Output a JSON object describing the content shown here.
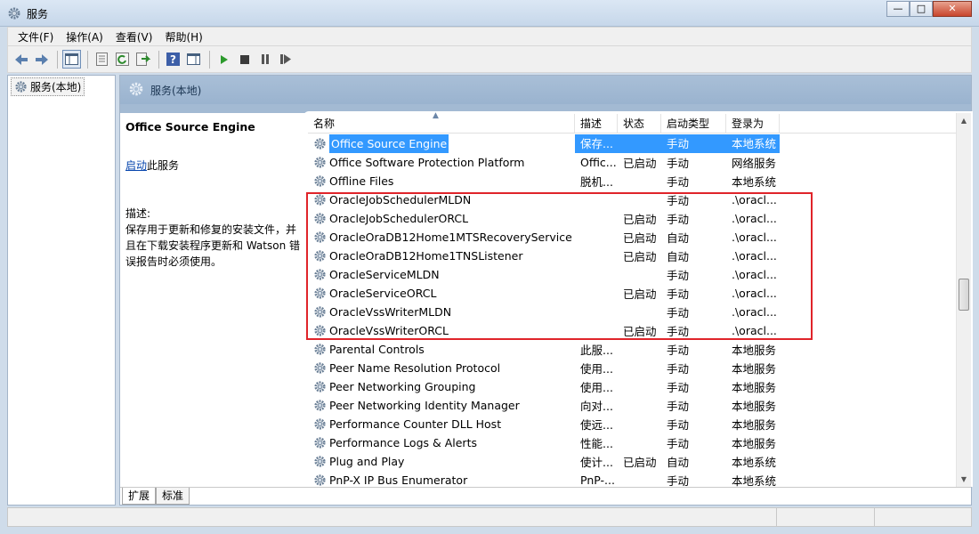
{
  "window": {
    "title": "服务",
    "buttons": {
      "minimize": "—",
      "maximize": "□",
      "close": "✕"
    }
  },
  "menu": [
    "文件(F)",
    "操作(A)",
    "查看(V)",
    "帮助(H)"
  ],
  "toolbar_icons": [
    "back-icon",
    "forward-icon",
    "console-tree-icon",
    "properties-icon",
    "refresh-icon",
    "export-list-icon",
    "help-icon",
    "show-action-pane-icon",
    "start-service-icon",
    "stop-service-icon",
    "pause-service-icon",
    "restart-service-icon"
  ],
  "tree": {
    "item_label": "服务(本地)"
  },
  "pane": {
    "header": "服务(本地)"
  },
  "details": {
    "title": "Office  Source Engine",
    "start_link": "启动",
    "start_suffix": "此服务",
    "desc_label": "描述:",
    "desc_text": "保存用于更新和修复的安装文件，并且在下载安装程序更新和 Watson 错误报告时必须使用。"
  },
  "columns": {
    "name": "名称",
    "desc": "描述",
    "status": "状态",
    "start": "启动类型",
    "logon": "登录为"
  },
  "rows": [
    {
      "name": "Office  Source Engine",
      "desc": "保存...",
      "status": "",
      "start": "手动",
      "logon": "本地系统"
    },
    {
      "name": "Office Software Protection Platform",
      "desc": "Offic...",
      "status": "已启动",
      "start": "手动",
      "logon": "网络服务"
    },
    {
      "name": "Offline Files",
      "desc": "脱机...",
      "status": "",
      "start": "手动",
      "logon": "本地系统"
    },
    {
      "name": "OracleJobSchedulerMLDN",
      "desc": "",
      "status": "",
      "start": "手动",
      "logon": ".\\oracl..."
    },
    {
      "name": "OracleJobSchedulerORCL",
      "desc": "",
      "status": "已启动",
      "start": "手动",
      "logon": ".\\oracl..."
    },
    {
      "name": "OracleOraDB12Home1MTSRecoveryService",
      "desc": "",
      "status": "已启动",
      "start": "自动",
      "logon": ".\\oracl..."
    },
    {
      "name": "OracleOraDB12Home1TNSListener",
      "desc": "",
      "status": "已启动",
      "start": "自动",
      "logon": ".\\oracl..."
    },
    {
      "name": "OracleServiceMLDN",
      "desc": "",
      "status": "",
      "start": "手动",
      "logon": ".\\oracl..."
    },
    {
      "name": "OracleServiceORCL",
      "desc": "",
      "status": "已启动",
      "start": "手动",
      "logon": ".\\oracl..."
    },
    {
      "name": "OracleVssWriterMLDN",
      "desc": "",
      "status": "",
      "start": "手动",
      "logon": ".\\oracl..."
    },
    {
      "name": "OracleVssWriterORCL",
      "desc": "",
      "status": "已启动",
      "start": "手动",
      "logon": ".\\oracl..."
    },
    {
      "name": "Parental Controls",
      "desc": "此服...",
      "status": "",
      "start": "手动",
      "logon": "本地服务"
    },
    {
      "name": "Peer Name Resolution Protocol",
      "desc": "使用...",
      "status": "",
      "start": "手动",
      "logon": "本地服务"
    },
    {
      "name": "Peer Networking Grouping",
      "desc": "使用...",
      "status": "",
      "start": "手动",
      "logon": "本地服务"
    },
    {
      "name": "Peer Networking Identity Manager",
      "desc": "向对...",
      "status": "",
      "start": "手动",
      "logon": "本地服务"
    },
    {
      "name": "Performance Counter DLL Host",
      "desc": "使远...",
      "status": "",
      "start": "手动",
      "logon": "本地服务"
    },
    {
      "name": "Performance Logs & Alerts",
      "desc": "性能...",
      "status": "",
      "start": "手动",
      "logon": "本地服务"
    },
    {
      "name": "Plug and Play",
      "desc": "使计...",
      "status": "已启动",
      "start": "自动",
      "logon": "本地系统"
    },
    {
      "name": "PnP-X IP Bus Enumerator",
      "desc": "PnP-...",
      "status": "",
      "start": "手动",
      "logon": "本地系统"
    }
  ],
  "selected_row_index": 0,
  "tabs": [
    "扩展",
    "标准"
  ],
  "active_tab": "扩展",
  "colors": {
    "selection": "#3399ff",
    "highlight_border": "#e0242a",
    "pane_header": "#a3bad3"
  }
}
